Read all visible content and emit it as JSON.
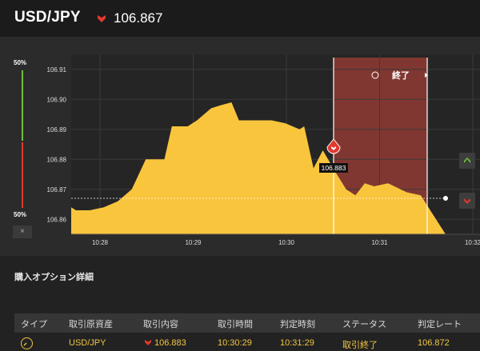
{
  "header": {
    "pair": "USD/JPY",
    "trend_icon": "triangle-down-icon",
    "rate": "106.867",
    "down_color": "#e0392f"
  },
  "sentiment": {
    "top_label": "50%",
    "bottom_label": "50%",
    "close_label": "×",
    "up_color": "#6fc13a",
    "down_color": "#e0392f"
  },
  "chart": {
    "end_label": "終了",
    "end_icon": "history-clock-icon",
    "entry_rate_label": "106.883",
    "current_rate_label": "",
    "area_color": "#f9c53d",
    "expiry_color": "#8c3a33"
  },
  "chart_data": {
    "type": "area",
    "x": [
      "10:28",
      "10:29",
      "10:30",
      "10:31",
      "10:32"
    ],
    "y_ticks": [
      "106.91",
      "106.90",
      "106.89",
      "106.88",
      "106.87",
      "106.86"
    ],
    "ylim": [
      106.855,
      106.915
    ],
    "series": [
      {
        "values": [
          [
            0,
            106.864
          ],
          [
            0.05,
            106.863
          ],
          [
            0.1,
            106.863
          ],
          [
            0.2,
            106.863
          ],
          [
            0.35,
            106.864
          ],
          [
            0.5,
            106.866
          ],
          [
            0.65,
            106.87
          ],
          [
            0.8,
            106.88
          ],
          [
            0.87,
            106.88
          ],
          [
            1.0,
            106.88
          ],
          [
            1.08,
            106.891
          ],
          [
            1.25,
            106.891
          ],
          [
            1.35,
            106.893
          ],
          [
            1.5,
            106.897
          ],
          [
            1.6,
            106.898
          ],
          [
            1.72,
            106.899
          ],
          [
            1.8,
            106.893
          ],
          [
            1.9,
            106.893
          ],
          [
            2.0,
            106.893
          ],
          [
            2.15,
            106.893
          ],
          [
            2.3,
            106.892
          ],
          [
            2.45,
            106.89
          ],
          [
            2.5,
            106.891
          ],
          [
            2.6,
            106.877
          ],
          [
            2.7,
            106.883
          ],
          [
            2.85,
            106.875
          ],
          [
            2.95,
            106.87
          ],
          [
            3.05,
            106.868
          ],
          [
            3.15,
            106.872
          ],
          [
            3.25,
            106.871
          ],
          [
            3.4,
            106.872
          ],
          [
            3.6,
            106.869
          ],
          [
            3.75,
            106.868
          ]
        ]
      }
    ],
    "entry": {
      "time": "10:30:29",
      "rate": 106.883
    },
    "expiry": {
      "time": "10:31:29"
    },
    "current_rate": 106.867,
    "grid": true
  },
  "details": {
    "title": "購入オプション詳細",
    "headers": [
      "タイプ",
      "取引原資産",
      "取引内容",
      "取引時間",
      "判定時刻",
      "ステータス",
      "判定レート"
    ],
    "row": {
      "type_icon": "clock-icon",
      "asset": "USD/JPY",
      "content_icon": "triangle-down-icon",
      "content": "106.883",
      "trade_time": "10:30:29",
      "judge_time": "10:31:29",
      "status": "取引終了",
      "judge_rate": "106.872"
    }
  }
}
